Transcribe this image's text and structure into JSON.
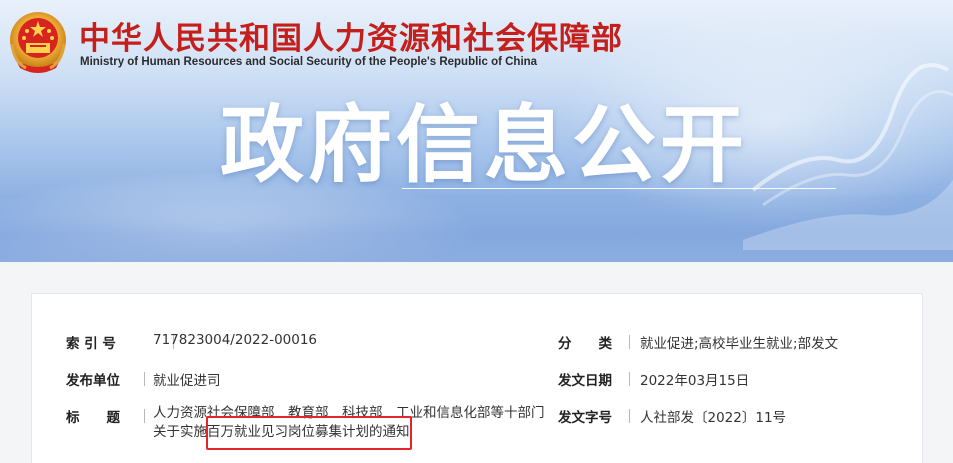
{
  "header": {
    "org_name_cn": "中华人民共和国人力资源和社会保障部",
    "org_name_en": "Ministry of Human Resources and Social Security of the People's Republic of China",
    "page_title": "政府信息公开"
  },
  "info": {
    "index_label": "索 引 号",
    "index_value": "717823004/2022-00016",
    "category_label": "分　　类",
    "category_value": "就业促进;高校毕业生就业;部发文",
    "publisher_label": "发布单位",
    "publisher_value": "就业促进司",
    "date_label": "发文日期",
    "date_value": "2022年03月15日",
    "title_label": "标　　题",
    "title_value": "人力资源社会保障部　教育部　科技部　工业和信息化部等十部门关于实施百万就业见习岗位募集计划的通知",
    "docnum_label": "发文字号",
    "docnum_value": "人社部发〔2022〕11号"
  },
  "colors": {
    "brand_red": "#c41f1a",
    "highlight_border": "#e4252c"
  }
}
